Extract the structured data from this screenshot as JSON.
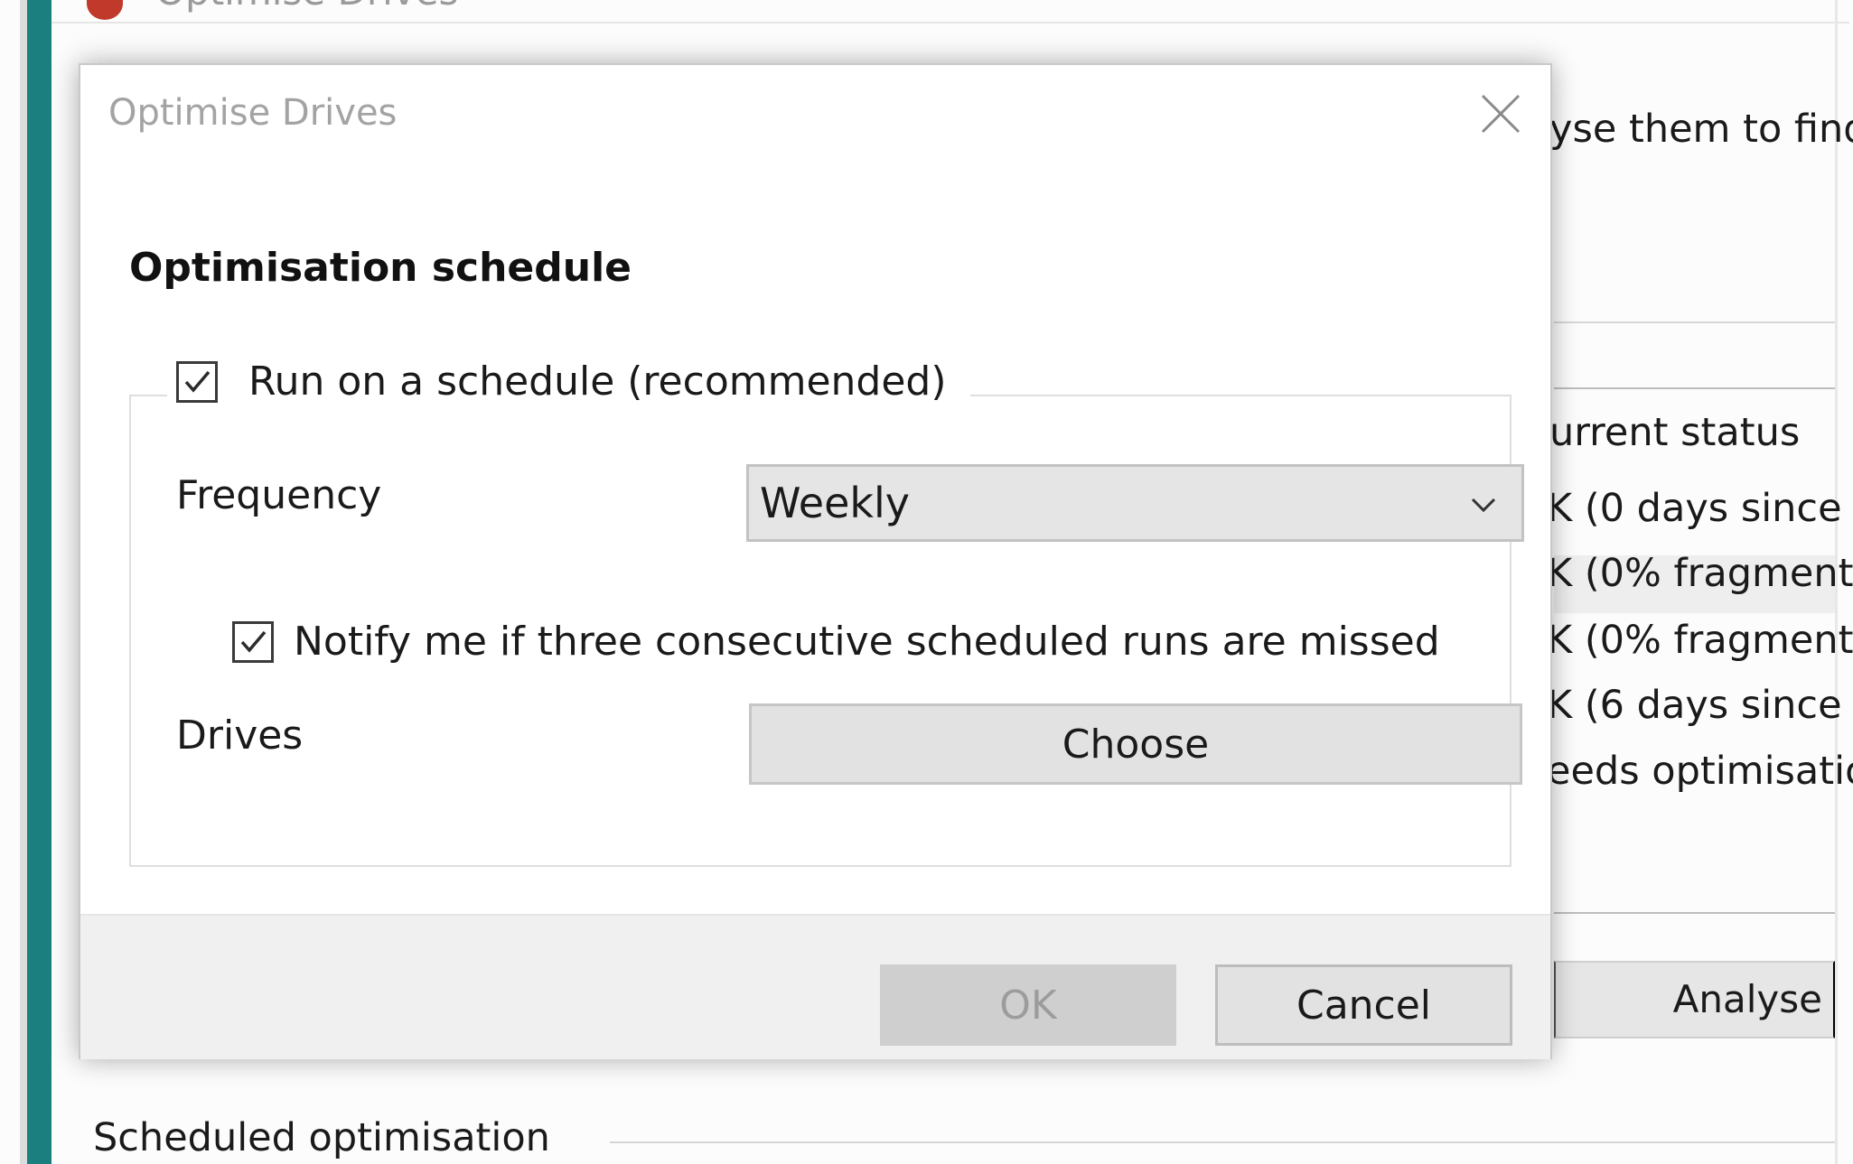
{
  "background_window": {
    "title": "Optimise Drives",
    "description_fragment": "yse them to find",
    "status_header": "urrent status",
    "status_rows": [
      "K (0 days since l",
      "K (0% fragment",
      "K (0% fragment",
      "K (6 days since l",
      "eeds optimisatio"
    ],
    "analyse_label": "Analyse",
    "scheduled_section_label": "Scheduled optimisation"
  },
  "dialog": {
    "title": "Optimise Drives",
    "close_icon": "close-icon",
    "heading": "Optimisation schedule",
    "run_on_schedule": {
      "label": "Run on a schedule (recommended)",
      "checked": true
    },
    "frequency": {
      "label": "Frequency",
      "selected": "Weekly"
    },
    "notify": {
      "label": "Notify me if three consecutive scheduled runs are missed",
      "checked": true
    },
    "drives": {
      "label": "Drives",
      "button_label": "Choose"
    },
    "ok_label": "OK",
    "ok_enabled": false,
    "cancel_label": "Cancel"
  },
  "colors": {
    "accent_bar": "#1a7f7e",
    "dialog_title_text": "#a3a3a3",
    "footer_background": "#f0f0f0",
    "disabled_button_text": "#9c9c9c"
  }
}
